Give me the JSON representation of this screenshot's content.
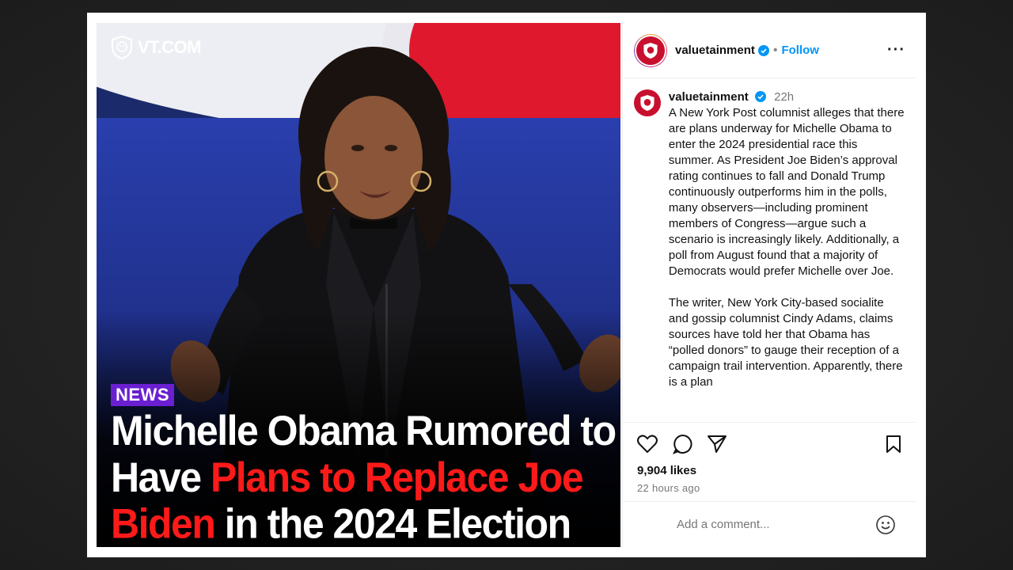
{
  "image": {
    "brand_logo_text": "VT.COM",
    "tag": "NEWS",
    "headline": {
      "line1": "Michelle Obama Rumored to",
      "line2_white": "Have ",
      "line2_red": "Plans to Replace Joe",
      "line3_red": "Biden",
      "line3_white": " in the 2024 Election"
    }
  },
  "post": {
    "username": "valuetainment",
    "follow_label": "Follow",
    "more_icon": "more-horizontal-icon",
    "caption_username": "valuetainment",
    "time": "22h",
    "caption_p1": "A New York Post columnist alleges that there are plans underway for Michelle Obama to enter the 2024 presidential race this summer. As President Joe Biden’s approval rating continues to fall and Donald Trump continuously outperforms him in the polls, many observers—including prominent members of Congress—argue such a scenario is increasingly likely. Additionally, a poll from August found that a majority of Democrats would prefer Michelle over Joe.",
    "caption_p2": "The writer, New York City-based socialite and gossip columnist Cindy Adams, claims sources have told her that Obama has “polled donors” to gauge their reception of a campaign trail intervention. Apparently, there is a plan",
    "likes": "9,904 likes",
    "posted_ago": "22 hours ago",
    "comment_placeholder": "Add a comment..."
  },
  "colors": {
    "follow_blue": "#0095f6",
    "brand_red": "#c8102e",
    "headline_red": "#ff1a1a",
    "news_tag_purple": "#6a1fd1"
  }
}
